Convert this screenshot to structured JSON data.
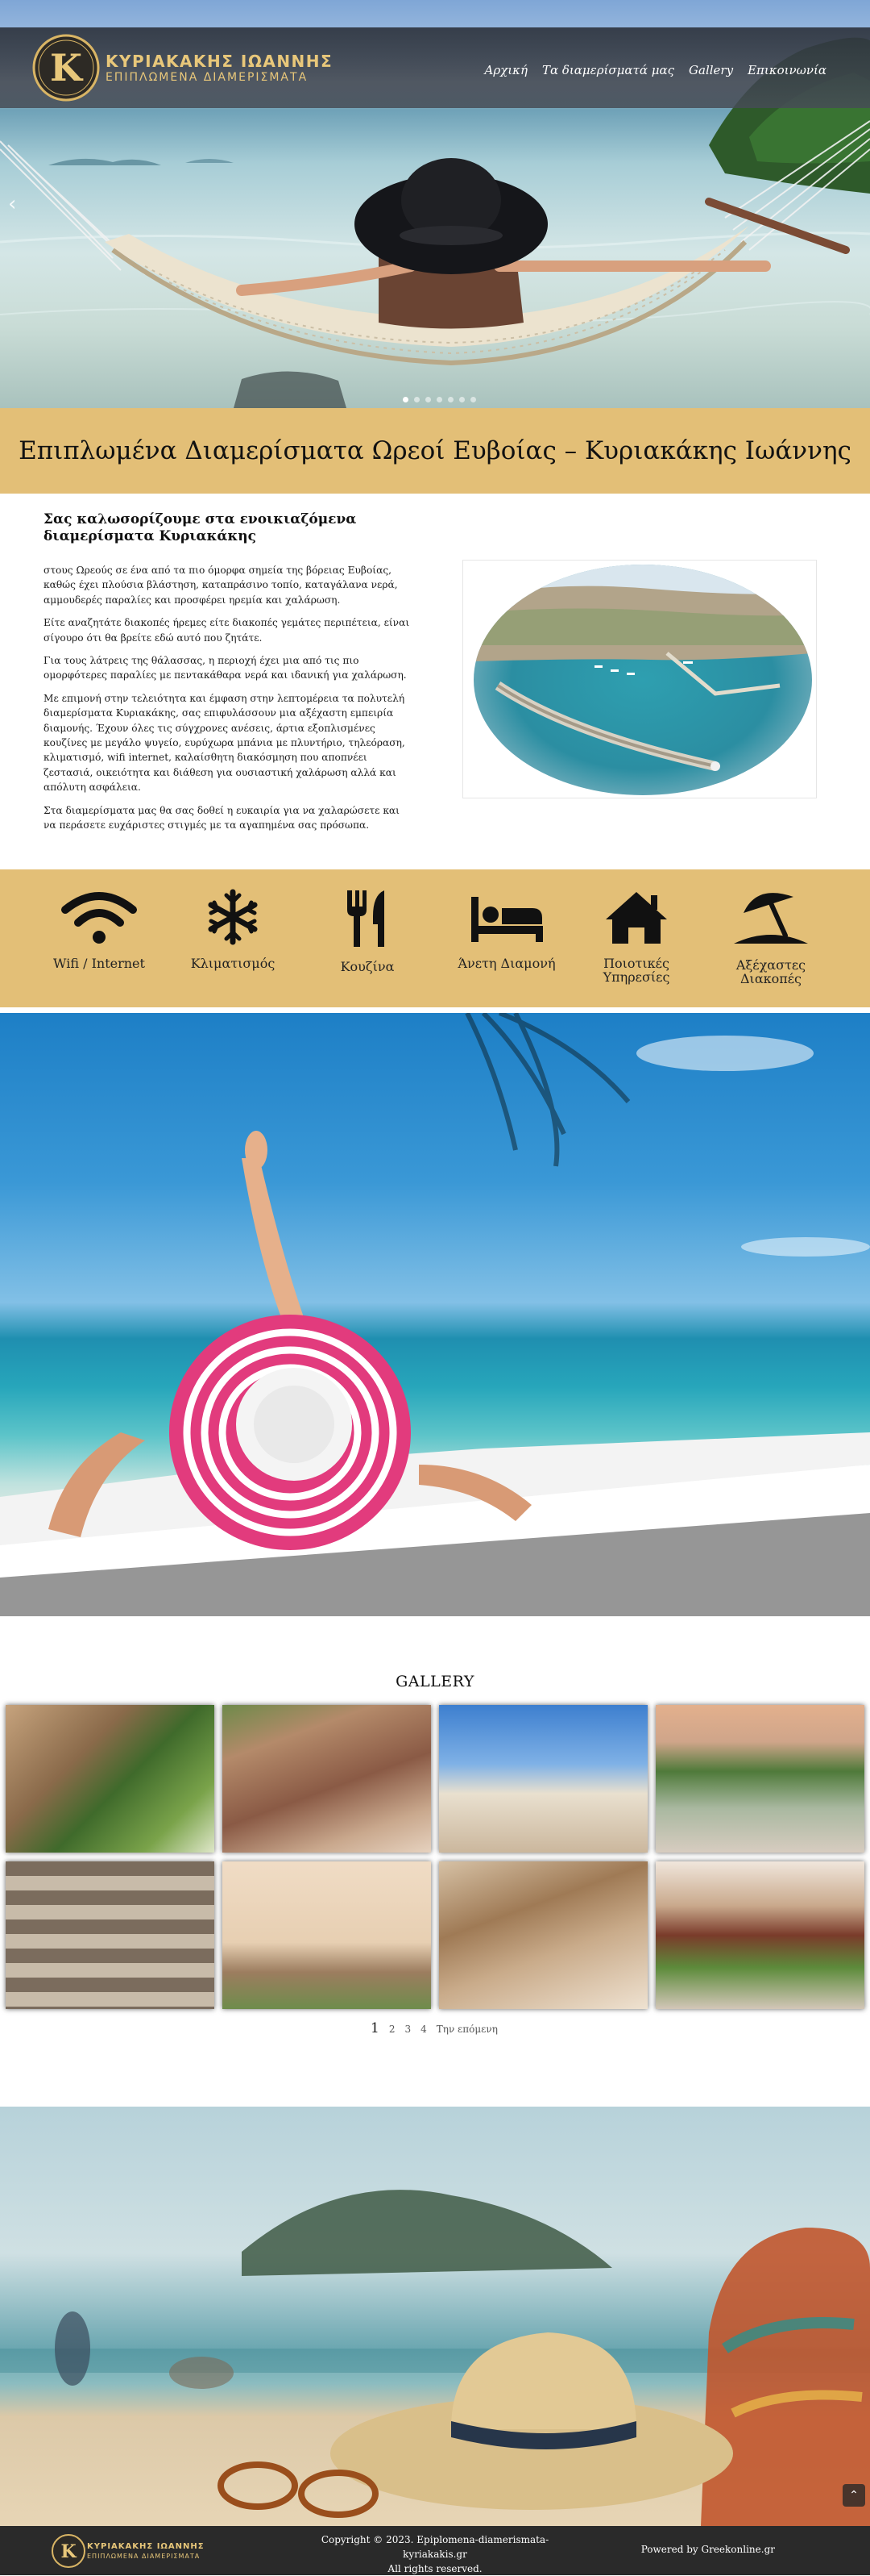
{
  "brand": {
    "name": "ΚΥΡΙΑΚΑΚΗΣ ΙΩΑΝΝΗΣ",
    "tagline": "ΕΠΙΠΛΩΜΕΝΑ ΔΙΑΜΕΡΙΣΜΑΤΑ",
    "monogram": "K",
    "gold": "#e8c77a"
  },
  "nav": {
    "items": [
      "Αρχική",
      "Τα διαμερίσματά μας",
      "Gallery",
      "Επικοινωνία"
    ]
  },
  "hero": {
    "prev_icon": "chevron-left-icon",
    "slide_count": 7,
    "active_slide": 1
  },
  "title_band": {
    "title": "Επιπλωμένα Διαμερίσματα Ωρεοί Ευβοίας – Κυριακάκης Ιωάννης"
  },
  "intro": {
    "heading": "Σας καλωσορίζουμε στα ενοικιαζόμενα διαμερίσματα Κυριακάκης",
    "paragraphs": [
      "στους Ωρεούς σε ένα από τα πιο όμορφα σημεία της βόρειας Ευβοίας, καθώς έχει πλούσια βλάστηση, καταπράσινο τοπίο, καταγάλανα νερά, αμμουδερές παραλίες και προσφέρει ηρεμία και χαλάρωση.",
      "Είτε αναζητάτε διακοπές ήρεμες είτε διακοπές γεμάτες περιπέτεια, είναι σίγουρο ότι θα βρείτε εδώ αυτό που ζητάτε.",
      "Για τους λάτρεις της θάλασσας, η περιοχή έχει μια από τις πιο ομορφότερες παραλίες με πεντακάθαρα νερά και ιδανική για χαλάρωση.",
      "Με επιμονή στην τελειότητα και έμφαση στην λεπτομέρεια τα πολυτελή διαμερίσματα Κυριακάκης, σας επιφυλάσσουν μια αξέχαστη εμπειρία διαμονής. Έχουν όλες τις σύγχρονες ανέσεις, άρτια εξοπλισμένες κουζίνες με μεγάλο ψυγείο, ευρύχωρα μπάνια με πλυντήριο, τηλεόραση, κλιματισμό, wifi internet, καλαίσθητη διακόσμηση που αποπνέει ζεστασιά, οικειότητα και διάθεση για ουσιαστική χαλάρωση αλλά και απόλυτη ασφάλεια.",
      "Στα διαμερίσματα μας θα σας δοθεί η ευκαιρία για να χαλαρώσετε και να περάσετε ευχάριστες στιγμές με τα αγαπημένα σας πρόσωπα."
    ]
  },
  "amenities": [
    {
      "icon": "wifi-icon",
      "label": "Wifi / Internet"
    },
    {
      "icon": "snowflake-icon",
      "label": "Κλιματισμός"
    },
    {
      "icon": "utensils-icon",
      "label": "Κουζίνα"
    },
    {
      "icon": "bed-icon",
      "label": "Άνετη Διαμονή"
    },
    {
      "icon": "home-icon",
      "label": "Ποιοτικές Υπηρεσίες"
    },
    {
      "icon": "umbrella-beach-icon",
      "label": "Αξέχαστες Διακοπές"
    }
  ],
  "gallery": {
    "title": "GALLERY",
    "pages": [
      "1",
      "2",
      "3",
      "4"
    ],
    "current_page": "1",
    "next_label": "Την επόμενη"
  },
  "footer": {
    "copyright": "Copyright © 2023. Epiplomena-diamerismata-kyriakakis.gr\nAll rights reserved.",
    "copyright_line1": "Copyright © 2023. Epiplomena-diamerismata-",
    "copyright_line2": "kyriakakis.gr",
    "copyright_line3": "All rights reserved.",
    "powered": "Powered by Greekonline.gr"
  },
  "scroll_top_icon": "chevron-up-icon"
}
